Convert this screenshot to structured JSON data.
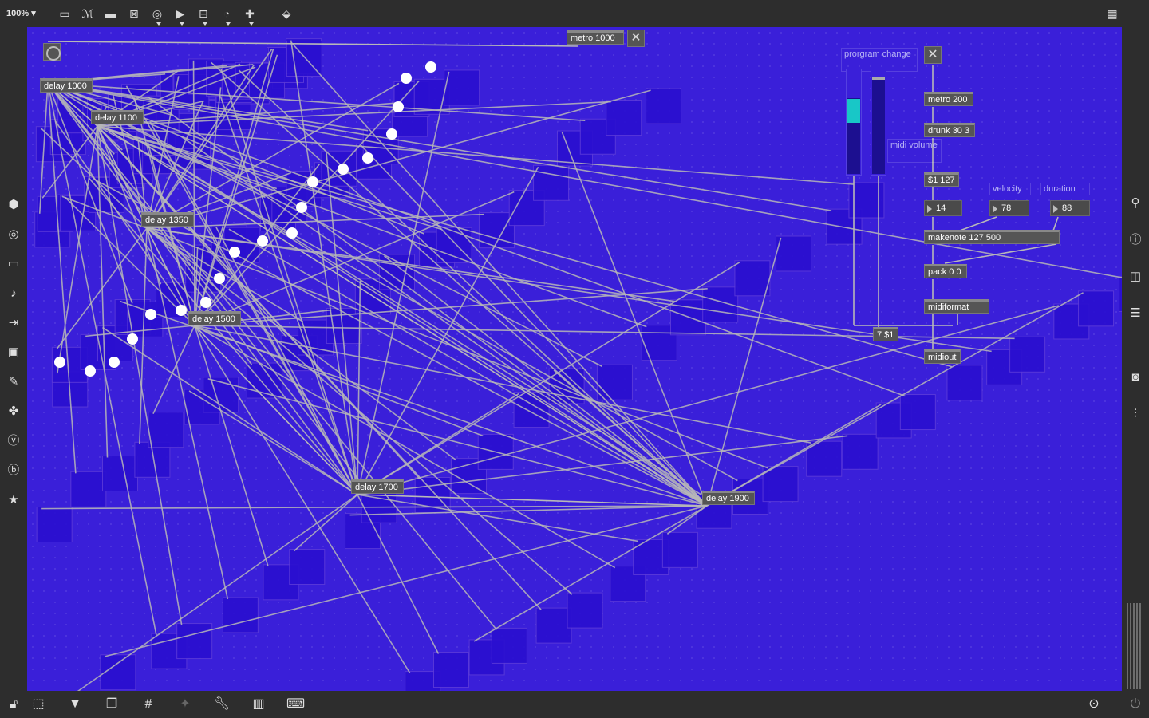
{
  "toolbar": {
    "zoom": "100%",
    "icons": [
      "presentation-icon",
      "text-icon",
      "comment-icon",
      "toggle-icon",
      "button-icon",
      "play-icon",
      "slider-icon",
      "dial-icon",
      "add-object-icon",
      "paint-bucket-icon"
    ]
  },
  "patch": {
    "metro_main": "metro 1000",
    "delays": [
      "delay 1000",
      "delay 1100",
      "delay 1350",
      "delay 1500",
      "delay 1700",
      "delay 1900"
    ],
    "program_change_label": "prorgram change",
    "midi_volume_label": "midi volume",
    "metro_200": "metro 200",
    "drunk": "drunk 30 3",
    "msg_127": "$1 127",
    "velocity_label": "velocity",
    "duration_label": "duration",
    "num_pitch": "14",
    "num_velocity": "78",
    "num_duration": "88",
    "makenote": "makenote 127 500",
    "pack": "pack 0 0",
    "midiformat": "midiformat",
    "msg_7": "7 $1",
    "midiout": "midiout",
    "program_change_slider": 0.72,
    "midi_volume_slider": 0.9
  },
  "colors": {
    "canvas": "#3a1fd9",
    "box": "#2a0fd0",
    "box_border": "#5b3ad8",
    "wire": "#b8b8b8",
    "cyan": "#18c7c7"
  }
}
